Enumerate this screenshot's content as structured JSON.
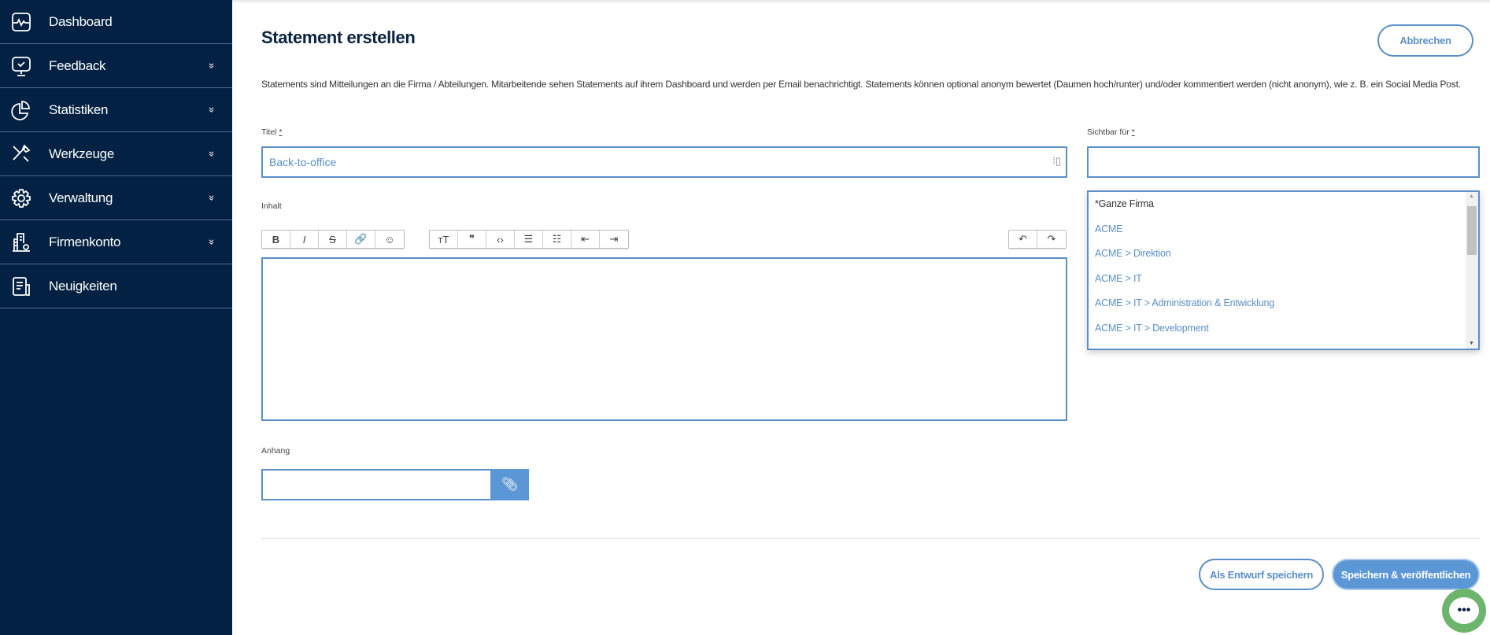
{
  "sidebar": {
    "items": [
      {
        "label": "Dashboard",
        "icon": "pulse-monitor-icon",
        "expandable": false
      },
      {
        "label": "Feedback",
        "icon": "feedback-monitor-icon",
        "expandable": true
      },
      {
        "label": "Statistiken",
        "icon": "pie-chart-icon",
        "expandable": true
      },
      {
        "label": "Werkzeuge",
        "icon": "tools-icon",
        "expandable": true
      },
      {
        "label": "Verwaltung",
        "icon": "gear-icon",
        "expandable": true
      },
      {
        "label": "Firmenkonto",
        "icon": "building-icon",
        "expandable": true
      },
      {
        "label": "Neuigkeiten",
        "icon": "newspaper-icon",
        "expandable": false
      }
    ]
  },
  "page": {
    "title": "Statement erstellen",
    "cancel_label": "Abbrechen",
    "description": "Statements sind Mitteilungen an die Firma / Abteilungen. Mitarbeitende sehen Statements auf ihrem Dashboard und werden per Email benachrichtigt. Statements können optional anonym bewertet (Daumen hoch/runter) und/oder kommentiert werden (nicht anonym), wie z. B. ein Social Media Post."
  },
  "form": {
    "title_label": "Titel",
    "required_mark": "*",
    "title_value": "Back-to-office",
    "visible_label": "Sichtbar für",
    "visible_value": "",
    "visible_options": [
      "*Ganze Firma",
      "ACME",
      "ACME > Direktion",
      "ACME > IT",
      "ACME > IT > Administration & Entwicklung",
      "ACME > IT > Development"
    ],
    "content_label": "Inhalt",
    "attachment_label": "Anhang"
  },
  "toolbar": {
    "group1": [
      {
        "label": "B",
        "name": "bold"
      },
      {
        "label": "I",
        "name": "italic"
      },
      {
        "label": "S",
        "name": "strikethrough"
      },
      {
        "label": "🔗",
        "name": "link"
      },
      {
        "label": "☺",
        "name": "emoji"
      }
    ],
    "group2": [
      {
        "label": "ᴛT",
        "name": "font-size"
      },
      {
        "label": "❞",
        "name": "quote"
      },
      {
        "label": "‹›",
        "name": "code"
      },
      {
        "label": "☰",
        "name": "bullet-list"
      },
      {
        "label": "☷",
        "name": "numbered-list"
      },
      {
        "label": "⇤",
        "name": "outdent"
      },
      {
        "label": "⇥",
        "name": "indent"
      }
    ],
    "group3": [
      {
        "label": "↶",
        "name": "undo"
      },
      {
        "label": "↷",
        "name": "redo"
      }
    ]
  },
  "footer": {
    "draft_label": "Als Entwurf speichern",
    "publish_label": "Speichern & veröffentlichen"
  },
  "colors": {
    "sidebar": "#032142",
    "accent": "#5b8fc7",
    "chat": "#6db56d"
  }
}
